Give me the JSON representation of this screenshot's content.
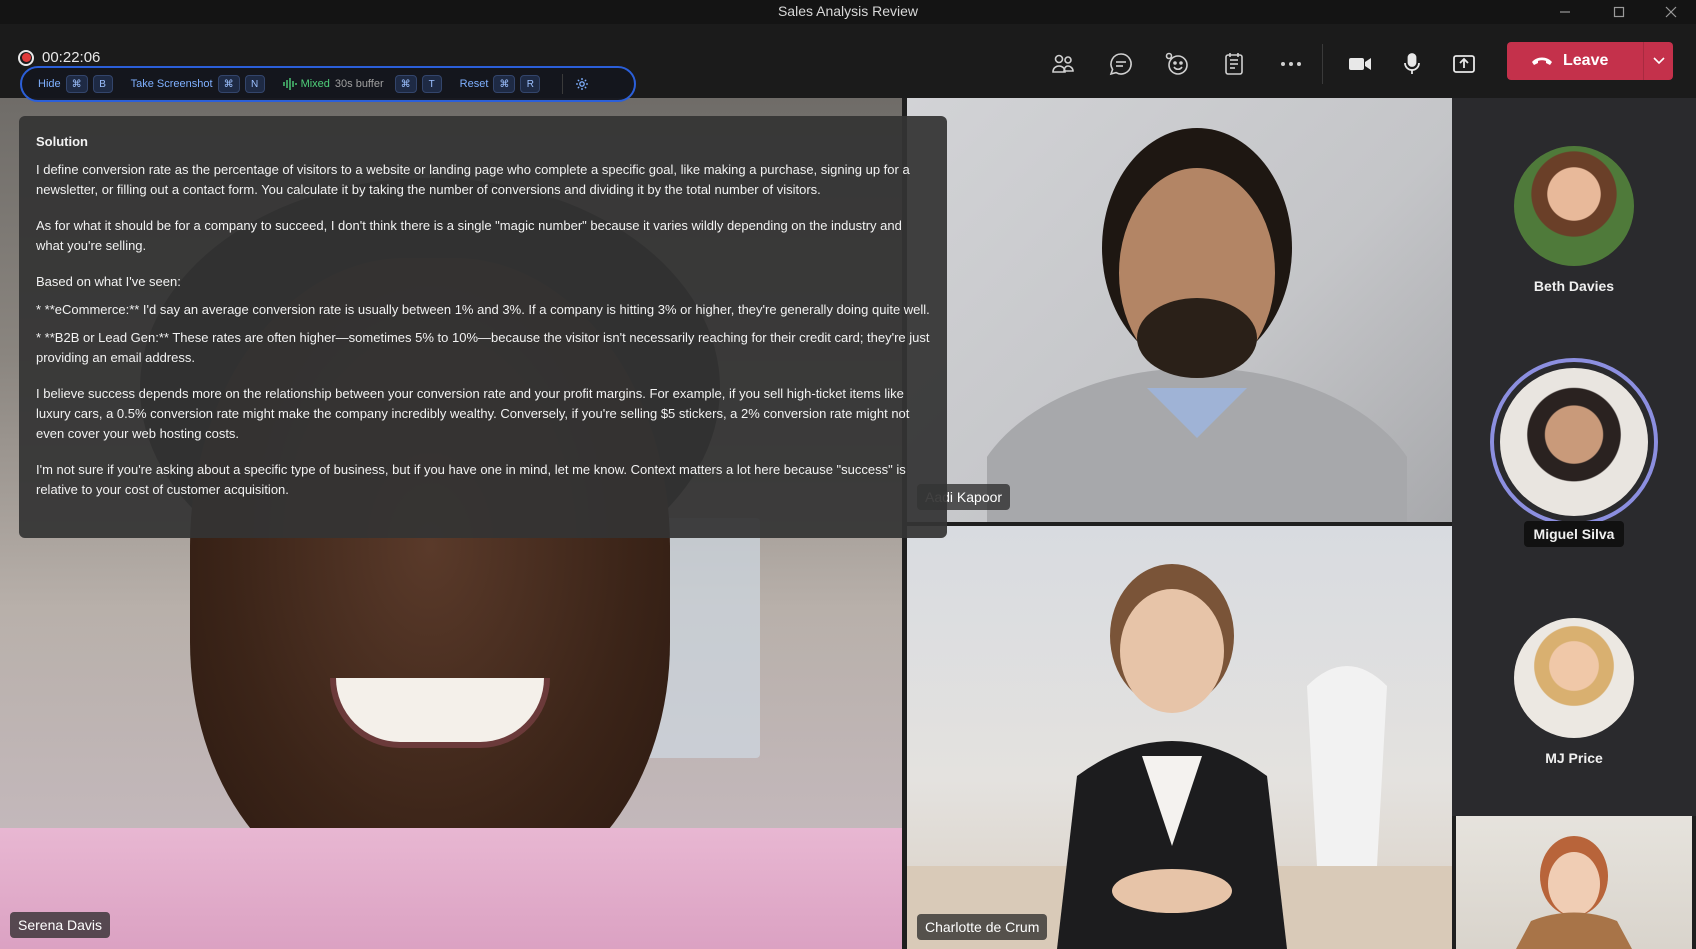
{
  "window": {
    "title": "Sales Analysis Review"
  },
  "recording": {
    "time": "00:22:06"
  },
  "overlay": {
    "hide_label": "Hide",
    "hide_keys": [
      "⌘",
      "B"
    ],
    "screenshot_label": "Take Screenshot",
    "screenshot_keys": [
      "⌘",
      "N"
    ],
    "mixed_label": "Mixed",
    "buffer_label": "30s buffer",
    "mixed_keys": [
      "⌘",
      "T"
    ],
    "reset_label": "Reset",
    "reset_keys": [
      "⌘",
      "R"
    ]
  },
  "toolbar": {
    "leave_label": "Leave",
    "icons": [
      "people-icon",
      "chat-icon",
      "reactions-icon",
      "notes-icon",
      "more-icon",
      "camera-icon",
      "mic-icon",
      "share-icon"
    ],
    "leave_color": "#c4314b"
  },
  "solution": {
    "heading": "Solution",
    "p1": "I define conversion rate as the percentage of visitors to a website or landing page who complete a specific goal, like making a purchase, signing up for a newsletter, or filling out a contact form. You calculate it by taking the number of conversions and dividing it by the total number of visitors.",
    "p2": "As for what it should be for a company to succeed, I don't think there is a single \"magic number\" because it varies wildly depending on the industry and what you're selling.",
    "p3": "Based on what I've seen:",
    "p4": "* **eCommerce:** I'd say an average conversion rate is usually between 1% and 3%. If a company is hitting 3% or higher, they're generally doing quite well.",
    "p5": "* **B2B or Lead Gen:** These rates are often higher—sometimes 5% to 10%—because the visitor isn't necessarily reaching for their credit card; they're just providing an email address.",
    "p6": "I believe success depends more on the relationship between your conversion rate and your profit margins. For example, if you sell high-ticket items like luxury cars, a 0.5% conversion rate might make the company incredibly wealthy. Conversely, if you're selling $5 stickers, a 2% conversion rate might not even cover your web hosting costs.",
    "p7": "I'm not sure if you're asking about a specific type of business, but if you have one in mind, let me know. Context matters a lot here because \"success\" is relative to your cost of customer acquisition."
  },
  "participants": {
    "main": "Serena Davis",
    "top_right": "Aadi Kapoor",
    "bottom_right": "Charlotte de Crum",
    "roster": [
      {
        "name": "Beth Davies"
      },
      {
        "name": "Miguel Silva"
      },
      {
        "name": "MJ Price"
      }
    ]
  }
}
